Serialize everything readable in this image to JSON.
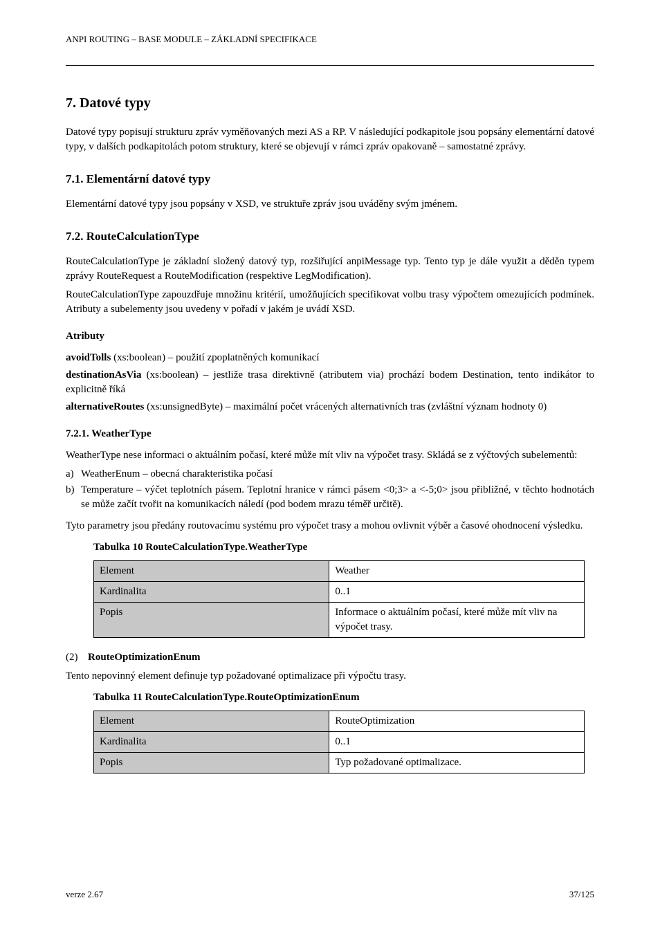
{
  "header": {
    "title": "ANPI ROUTING – BASE MODULE – ZÁKLADNÍ SPECIFIKACE"
  },
  "section": {
    "number": "7.",
    "title": "Datové typy"
  },
  "intro": "Datové typy popisují strukturu zpráv vyměňovaných mezi AS a RP. V následující podkapitole jsou popsány elementární datové typy, v dalších podkapitolách potom struktury, které se objevují v rámci zpráv opakovaně – samostatné zprávy.",
  "sub_71": {
    "title": "7.1. Elementární datové typy",
    "text": "Elementární datové typy jsou popsány v XSD, ve struktuře zpráv jsou uváděny svým jménem."
  },
  "sub_72": {
    "title": "7.2. RouteCalculationType",
    "para1": "RouteCalculationType je základní složený datový typ, rozšiřující anpiMessage typ. Tento typ je dále využit a děděn typem zprávy RouteRequest a RouteModification (respektive LegModification).",
    "para2": "RouteCalculationType zapouzdřuje množinu kritérií, umožňujících specifikovat volbu trasy výpočtem omezujících podmínek. Atributy a subelementy jsou uvedeny v pořadí v jakém je uvádí XSD."
  },
  "attributes_heading": "Atributy",
  "attributes": [
    {
      "name": "avoidTolls",
      "type": "xs:boolean",
      "desc": "použití zpoplatněných komunikací"
    },
    {
      "name": "destinationAsVia",
      "type": "xs:boolean",
      "desc": "jestliže trasa direktivně (atributem via) prochází bodem Destination, tento indikátor to explicitně říká"
    },
    {
      "name": "alternativeRoutes",
      "type": "xs:unsignedByte",
      "desc": "maximální počet vrácených alternativních tras (zvláštní význam hodnoty 0)"
    }
  ],
  "subsub_721": {
    "title": "7.2.1. WeatherType",
    "intro1": "WeatherType nese informaci o aktuálním počasí, které může mít vliv na výpočet trasy. Skládá se z výčtových subelementů:",
    "enum": [
      {
        "label": "a)",
        "text": "WeatherEnum – obecná charakteristika počasí"
      },
      {
        "label": "b)",
        "text": "Temperature – výčet teplotních pásem. Teplotní hranice v rámci pásem <0;3> a <-5;0> jsou přibližné, v těchto hodnotách se může začít tvořit na komunikacích náledí (pod bodem mrazu téměř určitě)."
      }
    ],
    "after_enum": "Tyto parametry jsou předány routovacímu systému pro výpočet trasy a mohou ovlivnit výběr a časové ohodnocení výsledku."
  },
  "table1": {
    "caption": "Tabulka 10 RouteCalculationType.WeatherType",
    "rows": [
      {
        "k": "Element",
        "v": "Weather"
      },
      {
        "k": "Kardinalita",
        "v": "0..1"
      },
      {
        "k": "Popis",
        "v": "Informace o aktuálním počasí, které může mít vliv na výpočet trasy."
      }
    ]
  },
  "subsub_722": {
    "paren_label": "(2)",
    "title": "RouteOptimizationEnum",
    "intro": "Tento nepovinný element definuje typ požadované optimalizace při výpočtu trasy."
  },
  "table2": {
    "caption": "Tabulka 11 RouteCalculationType.RouteOptimizationEnum",
    "rows": [
      {
        "k": "Element",
        "v": "RouteOptimization"
      },
      {
        "k": "Kardinalita",
        "v": "0..1"
      },
      {
        "k": "Popis",
        "v": "Typ požadované optimalizace."
      }
    ]
  },
  "footer": {
    "left": "verze 2.67",
    "right": "37/125"
  }
}
